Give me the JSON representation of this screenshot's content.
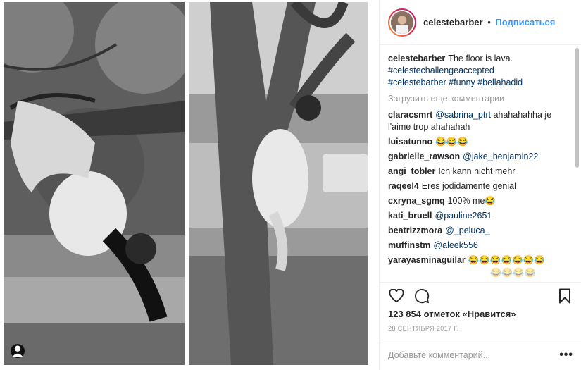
{
  "header": {
    "username": "celestebarber",
    "separator": "•",
    "follow_label": "Подписаться"
  },
  "caption": {
    "username": "celestebarber",
    "text": "The floor is lava.",
    "hashtags_line1": "#celestechallengeaccepted",
    "hashtags_line2": "#celestebarber #funny #bellahadid"
  },
  "load_more_label": "Загрузить еще комментарии",
  "comments": [
    {
      "user": "claracsmrt",
      "mention": "@sabrina_ptrt",
      "text": "ahahahahha je l'aime trop ahahahah"
    },
    {
      "user": "luisatunno",
      "text": "😂😂😂"
    },
    {
      "user": "gabrielle_rawson",
      "mention": "@jake_benjamin22",
      "text": ""
    },
    {
      "user": "angi_tobler",
      "text": "Ich kann nicht mehr"
    },
    {
      "user": "raqeel4",
      "text": "Eres jodidamente genial"
    },
    {
      "user": "cxryna_sgmq",
      "text": "100% me😂"
    },
    {
      "user": "kati_bruell",
      "mention": "@pauline2651",
      "text": ""
    },
    {
      "user": "beatrizzmora",
      "mention": "@_peluca_",
      "text": ""
    },
    {
      "user": "muffinstm",
      "mention": "@aleek556",
      "text": ""
    },
    {
      "user": "yarayasminaguilar",
      "text": "😂😂😂😂😂😂😂"
    }
  ],
  "partial_row": "😂😂😂😂",
  "likes_text": "123 854 отметок «Нравится»",
  "date_text": "28 СЕНТЯБРЯ 2017 Г.",
  "add_comment_placeholder": "Добавьте комментарий...",
  "more_label": "•••",
  "colors": {
    "link": "#3897f0",
    "mention": "#003569",
    "muted": "#999999",
    "text": "#262626"
  },
  "icons": [
    "user-tag-icon",
    "heart-icon",
    "comment-icon",
    "bookmark-icon"
  ]
}
